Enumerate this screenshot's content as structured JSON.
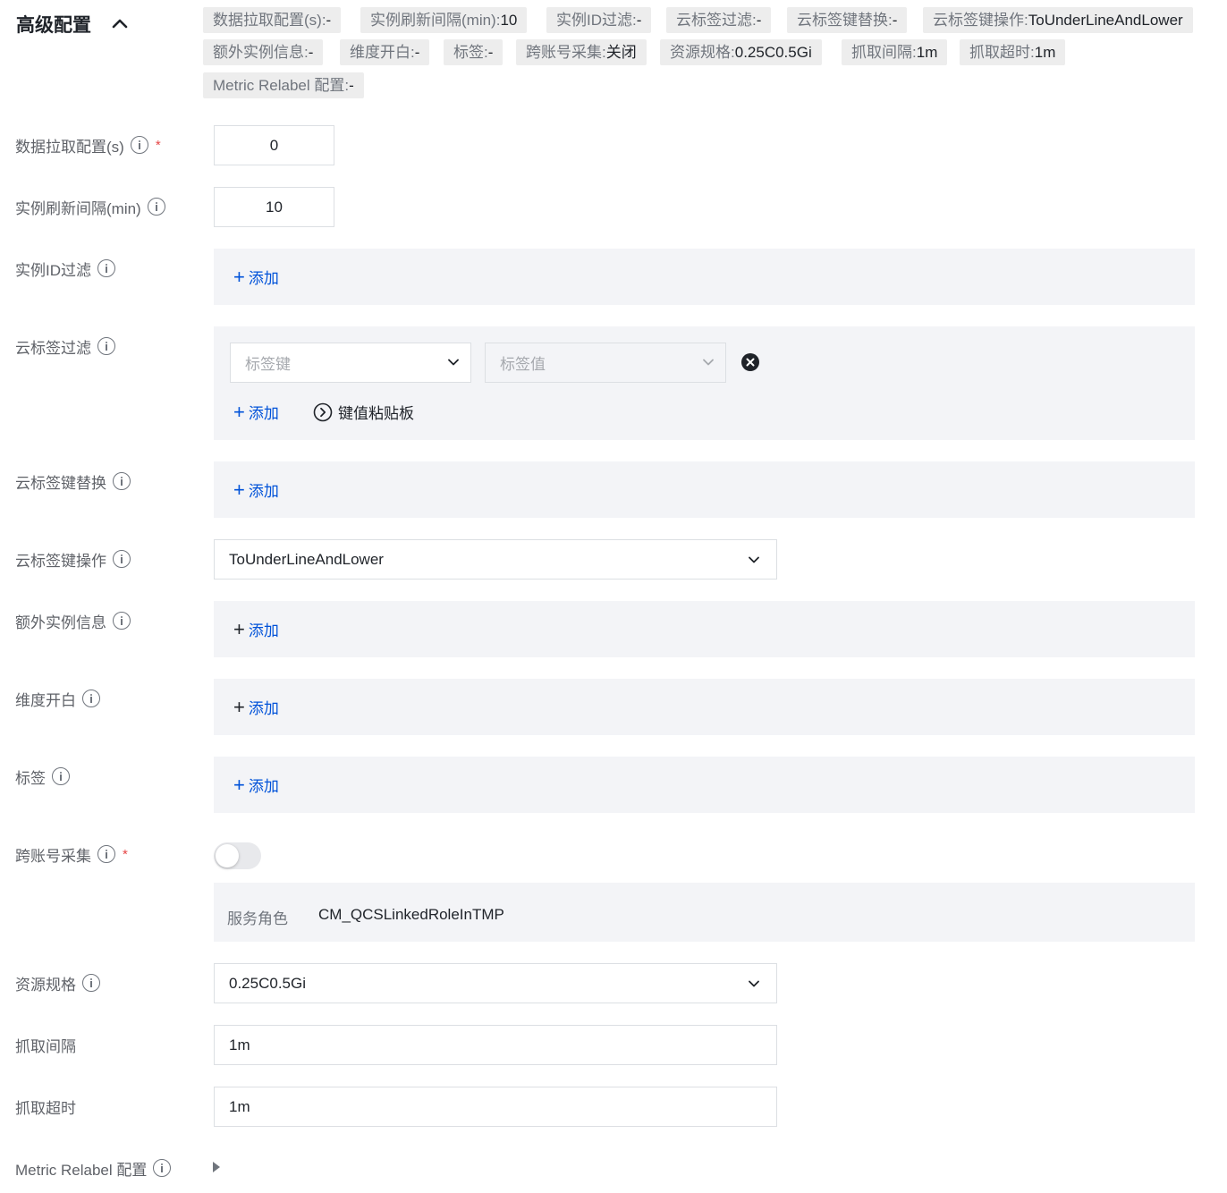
{
  "header": {
    "title": "高级配置"
  },
  "summary": [
    {
      "key": "数据拉取配置(s):",
      "val": "-"
    },
    {
      "key": "实例刷新间隔(min):",
      "val": "10"
    },
    {
      "key": "实例ID过滤:",
      "val": "-"
    },
    {
      "key": "云标签过滤:",
      "val": "-"
    },
    {
      "key": "云标签键替换:",
      "val": "-"
    },
    {
      "key": "云标签键操作:",
      "val": "ToUnderLineAndLower"
    },
    {
      "key": "额外实例信息:",
      "val": "-"
    },
    {
      "key": "维度开白:",
      "val": "-"
    },
    {
      "key": "标签:",
      "val": "-"
    },
    {
      "key": "跨账号采集:",
      "val": "关闭"
    },
    {
      "key": "资源规格:",
      "val": "0.25C0.5Gi"
    },
    {
      "key": "抓取间隔:",
      "val": "1m"
    },
    {
      "key": "抓取超时:",
      "val": "1m"
    },
    {
      "key": "Metric Relabel 配置:",
      "val": "-"
    }
  ],
  "form": {
    "pull_config": {
      "label": "数据拉取配置(s)",
      "value": "0",
      "required": "*"
    },
    "refresh_interval": {
      "label": "实例刷新间隔(min)",
      "value": "10"
    },
    "instance_id_filter": {
      "label": "实例ID过滤",
      "add": "添加"
    },
    "cloud_tag_filter": {
      "label": "云标签过滤",
      "key_placeholder": "标签键",
      "value_placeholder": "标签值",
      "add": "添加",
      "clipboard": "键值粘贴板"
    },
    "tag_key_replace": {
      "label": "云标签键替换",
      "add": "添加"
    },
    "tag_key_op": {
      "label": "云标签键操作",
      "value": "ToUnderLineAndLower"
    },
    "extra_info": {
      "label": "额外实例信息",
      "add": "添加"
    },
    "dimension_whitelist": {
      "label": "维度开白",
      "add": "添加"
    },
    "tags": {
      "label": "标签",
      "add": "添加"
    },
    "cross_account": {
      "label": "跨账号采集",
      "required": "*",
      "enabled": false,
      "service_role_label": "服务角色",
      "service_role_value": "CM_QCSLinkedRoleInTMP"
    },
    "resource_spec": {
      "label": "资源规格",
      "value": "0.25C0.5Gi"
    },
    "scrape_interval": {
      "label": "抓取间隔",
      "value": "1m"
    },
    "scrape_timeout": {
      "label": "抓取超时",
      "value": "1m"
    },
    "metric_relabel": {
      "label": "Metric Relabel 配置"
    }
  },
  "colors": {
    "accent": "#0052d9",
    "required": "#e54545",
    "panel_bg": "#f3f4f7",
    "chip_bg": "#ededed"
  }
}
